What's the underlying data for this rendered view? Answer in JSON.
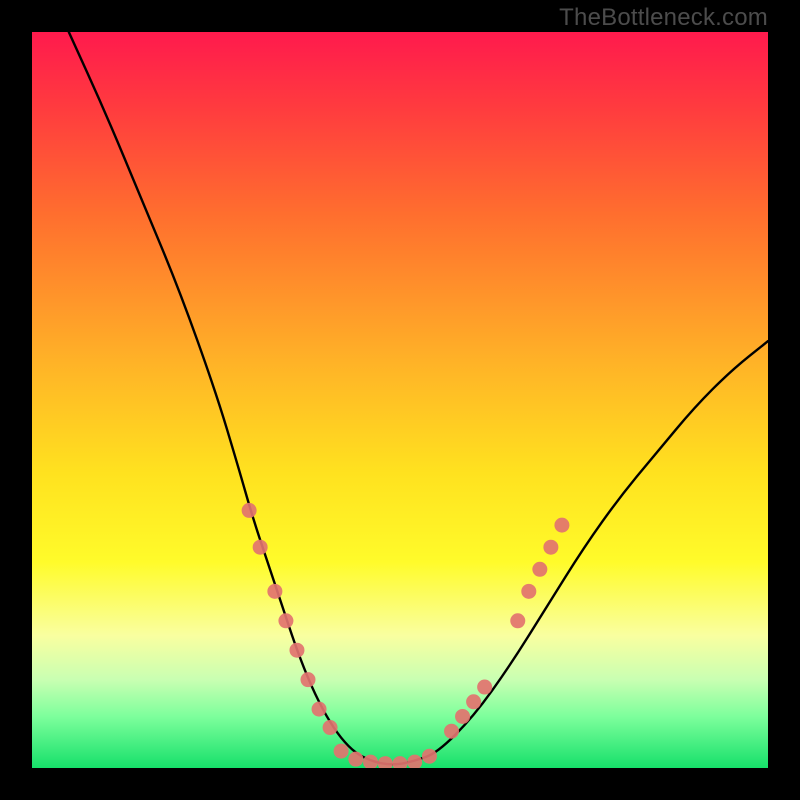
{
  "watermark": "TheBottleneck.com",
  "frame": {
    "outer_w": 800,
    "outer_h": 800,
    "inner_left": 32,
    "inner_top": 32,
    "inner_w": 736,
    "inner_h": 736
  },
  "chart_data": {
    "type": "line",
    "title": "",
    "xlabel": "",
    "ylabel": "",
    "xlim": [
      0,
      100
    ],
    "ylim": [
      0,
      100
    ],
    "grid": false,
    "legend": false,
    "series": [
      {
        "name": "bottleneck-curve",
        "color": "#000000",
        "x": [
          5,
          10,
          15,
          20,
          25,
          28,
          30,
          32,
          34,
          36,
          38,
          40,
          42,
          44,
          46,
          48,
          50,
          52,
          55,
          60,
          65,
          70,
          75,
          80,
          85,
          90,
          95,
          100
        ],
        "y": [
          100,
          89,
          77,
          65,
          51,
          41,
          34,
          28,
          22,
          16,
          11,
          7,
          4,
          2,
          1,
          0.5,
          0.5,
          1,
          2,
          7,
          14,
          22,
          30,
          37,
          43,
          49,
          54,
          58
        ]
      }
    ],
    "annotations": [
      {
        "name": "dots-left-branch",
        "color": "#e2736f",
        "points": [
          {
            "x": 29.5,
            "y": 35
          },
          {
            "x": 31,
            "y": 30
          },
          {
            "x": 33,
            "y": 24
          },
          {
            "x": 34.5,
            "y": 20
          },
          {
            "x": 36,
            "y": 16
          },
          {
            "x": 37.5,
            "y": 12
          },
          {
            "x": 39,
            "y": 8
          },
          {
            "x": 40.5,
            "y": 5.5
          }
        ]
      },
      {
        "name": "dots-valley",
        "color": "#e2736f",
        "points": [
          {
            "x": 42,
            "y": 2.3
          },
          {
            "x": 44,
            "y": 1.2
          },
          {
            "x": 46,
            "y": 0.8
          },
          {
            "x": 48,
            "y": 0.6
          },
          {
            "x": 50,
            "y": 0.6
          },
          {
            "x": 52,
            "y": 0.8
          },
          {
            "x": 54,
            "y": 1.6
          }
        ]
      },
      {
        "name": "dots-right-branch",
        "color": "#e2736f",
        "points": [
          {
            "x": 57,
            "y": 5
          },
          {
            "x": 58.5,
            "y": 7
          },
          {
            "x": 60,
            "y": 9
          },
          {
            "x": 61.5,
            "y": 11
          },
          {
            "x": 66,
            "y": 20
          },
          {
            "x": 67.5,
            "y": 24
          },
          {
            "x": 69,
            "y": 27
          },
          {
            "x": 70.5,
            "y": 30
          },
          {
            "x": 72,
            "y": 33
          }
        ]
      }
    ]
  }
}
